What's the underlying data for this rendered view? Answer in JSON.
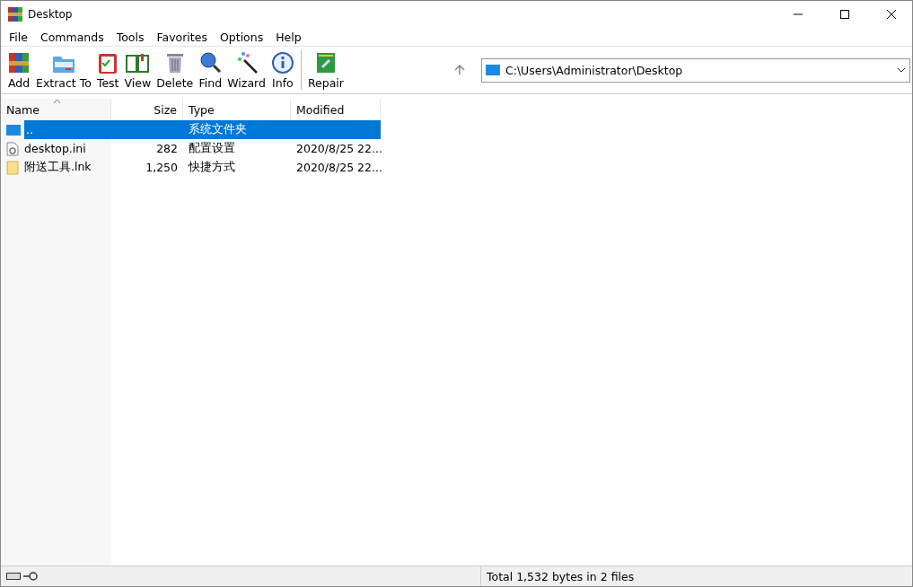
{
  "window": {
    "title": "Desktop"
  },
  "menu": [
    "File",
    "Commands",
    "Tools",
    "Favorites",
    "Options",
    "Help"
  ],
  "toolbar": [
    {
      "label": "Add",
      "kind": "add"
    },
    {
      "label": "Extract To",
      "kind": "extract"
    },
    {
      "label": "Test",
      "kind": "test"
    },
    {
      "label": "View",
      "kind": "view"
    },
    {
      "label": "Delete",
      "kind": "delete"
    },
    {
      "label": "Find",
      "kind": "find"
    },
    {
      "label": "Wizard",
      "kind": "wizard"
    },
    {
      "label": "Info",
      "kind": "info"
    },
    {
      "label": "Repair",
      "kind": "repair"
    }
  ],
  "address": {
    "value": "C:\\Users\\Administrator\\Desktop"
  },
  "table": {
    "columns": [
      "Name",
      "Size",
      "Type",
      "Modified"
    ],
    "rows": [
      {
        "kind": "folder",
        "name": "..",
        "size": "",
        "type": "系统文件夹",
        "modified": "",
        "selected": true
      },
      {
        "kind": "settings",
        "name": "desktop.ini",
        "size": "282",
        "type": "配置设置",
        "modified": "2020/8/25 22...",
        "selected": false
      },
      {
        "kind": "file",
        "name": "附送工具.lnk",
        "size": "1,250",
        "type": "快捷方式",
        "modified": "2020/8/25 22...",
        "selected": false
      }
    ]
  },
  "status_bar": {
    "text": "Total 1,532 bytes in 2 files"
  }
}
